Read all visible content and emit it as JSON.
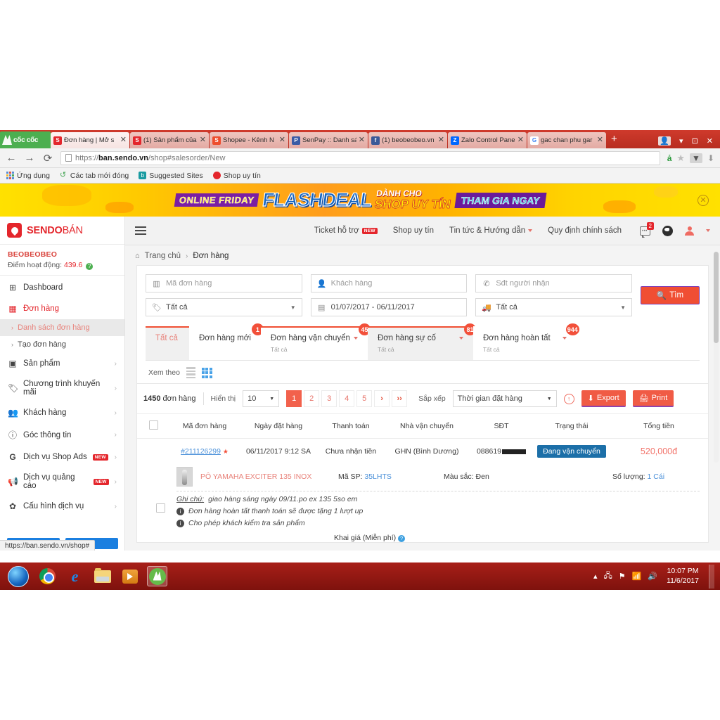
{
  "browser": {
    "home_button_label": "cốc cốc",
    "tabs": [
      {
        "title": "Đơn hàng | Mở s",
        "favicon": "sendo-icon",
        "color": "#e4262c",
        "letter": "S",
        "active": true
      },
      {
        "title": "(1) Sản phẩm của",
        "favicon": "shop-icon",
        "color": "#e4262c",
        "letter": "S",
        "active": false
      },
      {
        "title": "Shopee - Kênh N",
        "favicon": "shopee-icon",
        "color": "#ee4d2d",
        "letter": "S",
        "active": false
      },
      {
        "title": "SenPay :: Danh sá",
        "favicon": "senpay-icon",
        "color": "#3b5ba5",
        "letter": "P",
        "active": false
      },
      {
        "title": "(1) beobeobeo.vn",
        "favicon": "facebook-icon",
        "color": "#3b5998",
        "letter": "f",
        "active": false
      },
      {
        "title": "Zalo Control Pane",
        "favicon": "zalo-icon",
        "color": "#0068ff",
        "letter": "Z",
        "active": false
      },
      {
        "title": "gac chan phu gar",
        "favicon": "google-icon",
        "color": "#ffffff",
        "letter": "G",
        "active": false
      }
    ],
    "new_tab_label": "+",
    "window_controls": {
      "minimize": "▾",
      "maximize": "⊡",
      "close": "✕"
    },
    "nav": {
      "back": "←",
      "forward": "→",
      "reload": "⟳"
    },
    "url": {
      "scheme": "https://",
      "host": "ban.sendo.vn",
      "path": "/shop#salesorder/New"
    },
    "address_icons": {
      "translate": "ả",
      "bookmark": "★",
      "download_box": "▼",
      "download": "⬇"
    },
    "bookmarks": [
      {
        "label": "Ứng dụng",
        "icon": "apps-grid-icon"
      },
      {
        "label": "Các tab mới đóng",
        "icon": "recent-tabs-icon"
      },
      {
        "label": "Suggested Sites",
        "icon": "bing-icon"
      },
      {
        "label": "Shop uy tín",
        "icon": "sendo-icon"
      }
    ],
    "status_bar_url": "https://ban.sendo.vn/shop#"
  },
  "banner": {
    "text_left": "ONLINE FRIDAY",
    "text_main": "FLASHDEAL",
    "text_top": "DÀNH CHO",
    "text_bottom": "SHOP UY TÍN",
    "text_cta": "THAM GIA NGAY",
    "close_label": "✕"
  },
  "sidebar": {
    "brand_primary": "SENDO",
    "brand_secondary": "BÁN",
    "shop_name": "BEOBEOBEO",
    "points_label": "Điểm hoạt động:",
    "points_value": "439.6",
    "help_glyph": "?",
    "items": [
      {
        "label": "Dashboard",
        "icon": "dashboard-icon",
        "glyph": "⊞",
        "active": false,
        "chevron": ""
      },
      {
        "label": "Đơn hàng",
        "icon": "orders-icon",
        "glyph": "▦",
        "active": true,
        "chevron": ""
      },
      {
        "label": "Sản phẩm",
        "icon": "products-icon",
        "glyph": "▣",
        "active": false,
        "chevron": "›"
      },
      {
        "label": "Chương trình khuyến mãi",
        "icon": "promotion-tag-icon",
        "glyph": "🏷",
        "active": false,
        "chevron": "›"
      },
      {
        "label": "Khách hàng",
        "icon": "customers-icon",
        "glyph": "👥",
        "active": false,
        "chevron": "›"
      },
      {
        "label": "Góc thông tin",
        "icon": "info-icon",
        "glyph": "ⓘ",
        "active": false,
        "chevron": "›"
      },
      {
        "label": "Dịch vụ Shop Ads",
        "icon": "shop-ads-icon",
        "glyph": "G",
        "active": false,
        "chevron": "›",
        "badge": "NEW"
      },
      {
        "label": "Dịch vụ quảng cáo",
        "icon": "megaphone-icon",
        "glyph": "📢",
        "active": false,
        "chevron": "›",
        "badge": "NEW"
      },
      {
        "label": "Cấu hình dịch vụ",
        "icon": "gear-icon",
        "glyph": "✿",
        "active": false,
        "chevron": "›"
      }
    ],
    "sub_items": [
      {
        "label": "Danh sách đơn hàng",
        "selected": true
      },
      {
        "label": "Tạo đơn hàng",
        "selected": false
      }
    ]
  },
  "topbar": {
    "menu_toggle": "hamburger-icon",
    "links": [
      {
        "label": "Ticket hỗ trợ",
        "badge": "NEW",
        "caret": false
      },
      {
        "label": "Shop uy tín",
        "badge": "",
        "caret": false
      },
      {
        "label": "Tin tức & Hướng dẫn",
        "badge": "",
        "caret": true
      },
      {
        "label": "Quy định chính sách",
        "badge": "",
        "caret": false
      }
    ],
    "chat_badge": "2",
    "chat_dots": "•••"
  },
  "breadcrumb": {
    "home": "Trang chủ",
    "separator": "›",
    "current": "Đơn hàng"
  },
  "filters": {
    "order_code": {
      "placeholder": "Mã đơn hàng",
      "value": "",
      "icon": "barcode-icon"
    },
    "customer": {
      "placeholder": "Khách hàng",
      "value": "",
      "icon": "person-icon"
    },
    "phone": {
      "placeholder": "Sđt người nhận",
      "value": "",
      "icon": "phone-icon"
    },
    "tag": {
      "value": "Tất cả",
      "icon": "tag-icon"
    },
    "date_range": {
      "value": "01/07/2017 - 06/11/2017",
      "icon": "calendar-icon"
    },
    "shipping": {
      "value": "Tất cả",
      "icon": "truck-icon"
    },
    "search_button": {
      "label": "Tìm",
      "icon": "search-icon"
    }
  },
  "order_tabs": [
    {
      "label": "Tất cả",
      "sub": "",
      "badge": "",
      "selected": true,
      "barred": false
    },
    {
      "label": "Đơn hàng mới",
      "sub": "",
      "badge": "1",
      "selected": false,
      "barred": false,
      "caret": false
    },
    {
      "label": "Đơn hàng vận chuyển",
      "sub": "Tất cả",
      "badge": "45",
      "selected": false,
      "barred": true,
      "caret": true
    },
    {
      "label": "Đơn hàng sự cố",
      "sub": "Tất cả",
      "badge": "81",
      "selected": true,
      "barred": true,
      "caret": true
    },
    {
      "label": "Đơn hàng hoàn tất",
      "sub": "Tất cả",
      "badge": "944",
      "selected": false,
      "barred": false,
      "caret": true
    }
  ],
  "view_toggle": {
    "label": "Xem theo",
    "list_icon": "list-view-icon",
    "grid_icon": "grid-view-icon",
    "active": "grid"
  },
  "toolbar": {
    "total_count": "1450",
    "total_suffix": "đơn hàng",
    "show_label": "Hiển thị",
    "page_size": "10",
    "pages": [
      "1",
      "2",
      "3",
      "4",
      "5"
    ],
    "next_label": "›",
    "last_label": "››",
    "active_page": "1",
    "sort_label": "Sắp xếp",
    "sort_value": "Thời gian đặt hàng",
    "help_icon": "help-circle-icon",
    "export_label": "Export",
    "print_label": "Print"
  },
  "table": {
    "columns": [
      "Mã đơn hàng",
      "Ngày đặt hàng",
      "Thanh toán",
      "Nhà vận chuyển",
      "SĐT",
      "Trạng thái",
      "Tổng tiền"
    ],
    "rows": [
      {
        "order_id": "#211126299",
        "starred": true,
        "date": "06/11/2017 9:12 SA",
        "payment": "Chưa nhận tiền",
        "carrier": "GHN (Bình Dương)",
        "phone_visible": "088619",
        "status": "Đang vận chuyển",
        "total": "520,000đ",
        "product": {
          "name": "PÔ YAMAHA EXCITER 135 INOX",
          "sku_label": "Mã SP:",
          "sku": "35LHTS",
          "color_label": "Màu sắc:",
          "color": "Đen",
          "qty_label": "Số lượng:",
          "qty": "1 Cái"
        },
        "notes": [
          {
            "prefix": "Ghi chú:",
            "text": "giao hàng sáng ngày 09/11.po ex 135 5so em",
            "icon": ""
          },
          {
            "prefix": "",
            "text": "Đơn hàng hoàn tất thanh toán sẽ được tặng 1 lượt up",
            "icon": "info-icon"
          },
          {
            "prefix": "",
            "text": "Cho phép khách kiểm tra sản phẩm",
            "icon": "info-icon"
          }
        ],
        "partial_text": "Khai giá (Miễn phí)"
      }
    ]
  },
  "taskbar": {
    "start_label": "start-orb",
    "items": [
      {
        "name": "chrome-icon",
        "selected": false
      },
      {
        "name": "internet-explorer-icon",
        "selected": false
      },
      {
        "name": "file-explorer-icon",
        "selected": false
      },
      {
        "name": "media-player-icon",
        "selected": false
      },
      {
        "name": "coc-coc-icon",
        "selected": true
      }
    ],
    "tray_icons": [
      "show-hidden-icon",
      "network-error-icon",
      "action-center-icon",
      "signal-icon",
      "volume-icon"
    ],
    "time": "10:07 PM",
    "date": "11/6/2017"
  },
  "colors": {
    "brand_red": "#e4262c",
    "accent_orange": "#f04e33",
    "status_blue": "#1c6fa8",
    "link_blue": "#4a90d9",
    "money_red": "#f2736a"
  }
}
